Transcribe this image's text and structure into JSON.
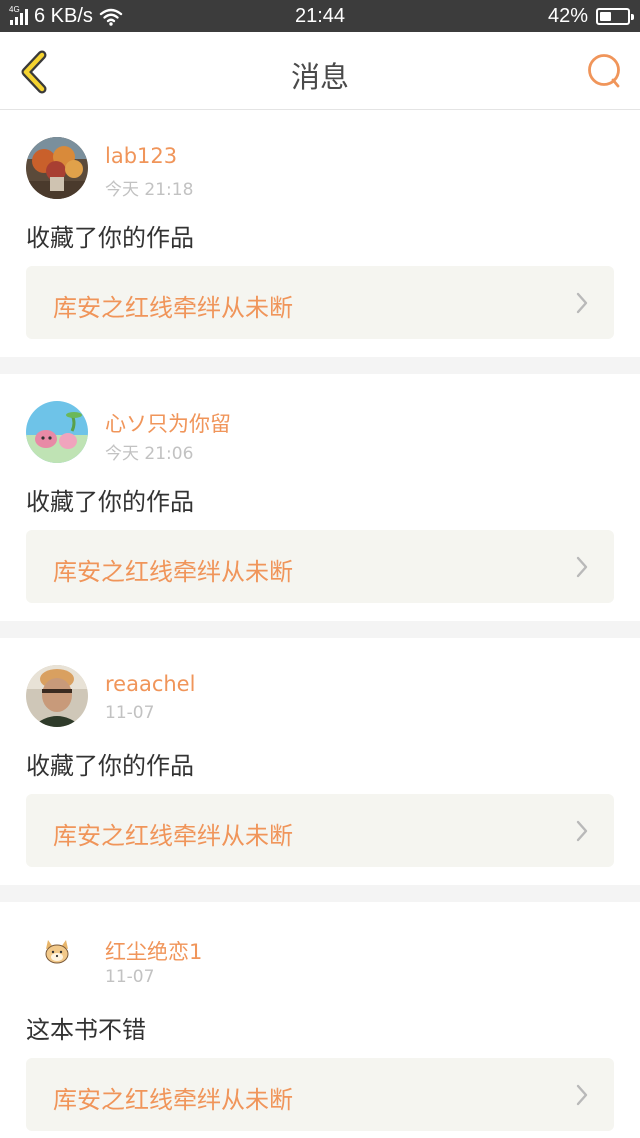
{
  "status_bar": {
    "network_tag": "4G",
    "speed": "6 KB/s",
    "time": "21:44",
    "battery": "42%",
    "battery_level": 0.42
  },
  "header": {
    "title": "消息",
    "back_icon": "chevron-left-icon",
    "search_icon": "search-icon",
    "accent_color": "#f0955a",
    "back_color": "#f5d330"
  },
  "messages": [
    {
      "username": "lab123",
      "time": "今天 21:18",
      "content": "收藏了你的作品",
      "work_title": "库安之红线牵绊从未断"
    },
    {
      "username": "心ソ只为你留",
      "time": "今天 21:06",
      "content": "收藏了你的作品",
      "work_title": "库安之红线牵绊从未断"
    },
    {
      "username": "reaachel",
      "time": "11-07",
      "content": "收藏了你的作品",
      "work_title": "库安之红线牵绊从未断"
    },
    {
      "username": "红尘绝恋1",
      "time": "11-07",
      "content": "这本书不错",
      "work_title": "库安之红线牵绊从未断"
    }
  ]
}
